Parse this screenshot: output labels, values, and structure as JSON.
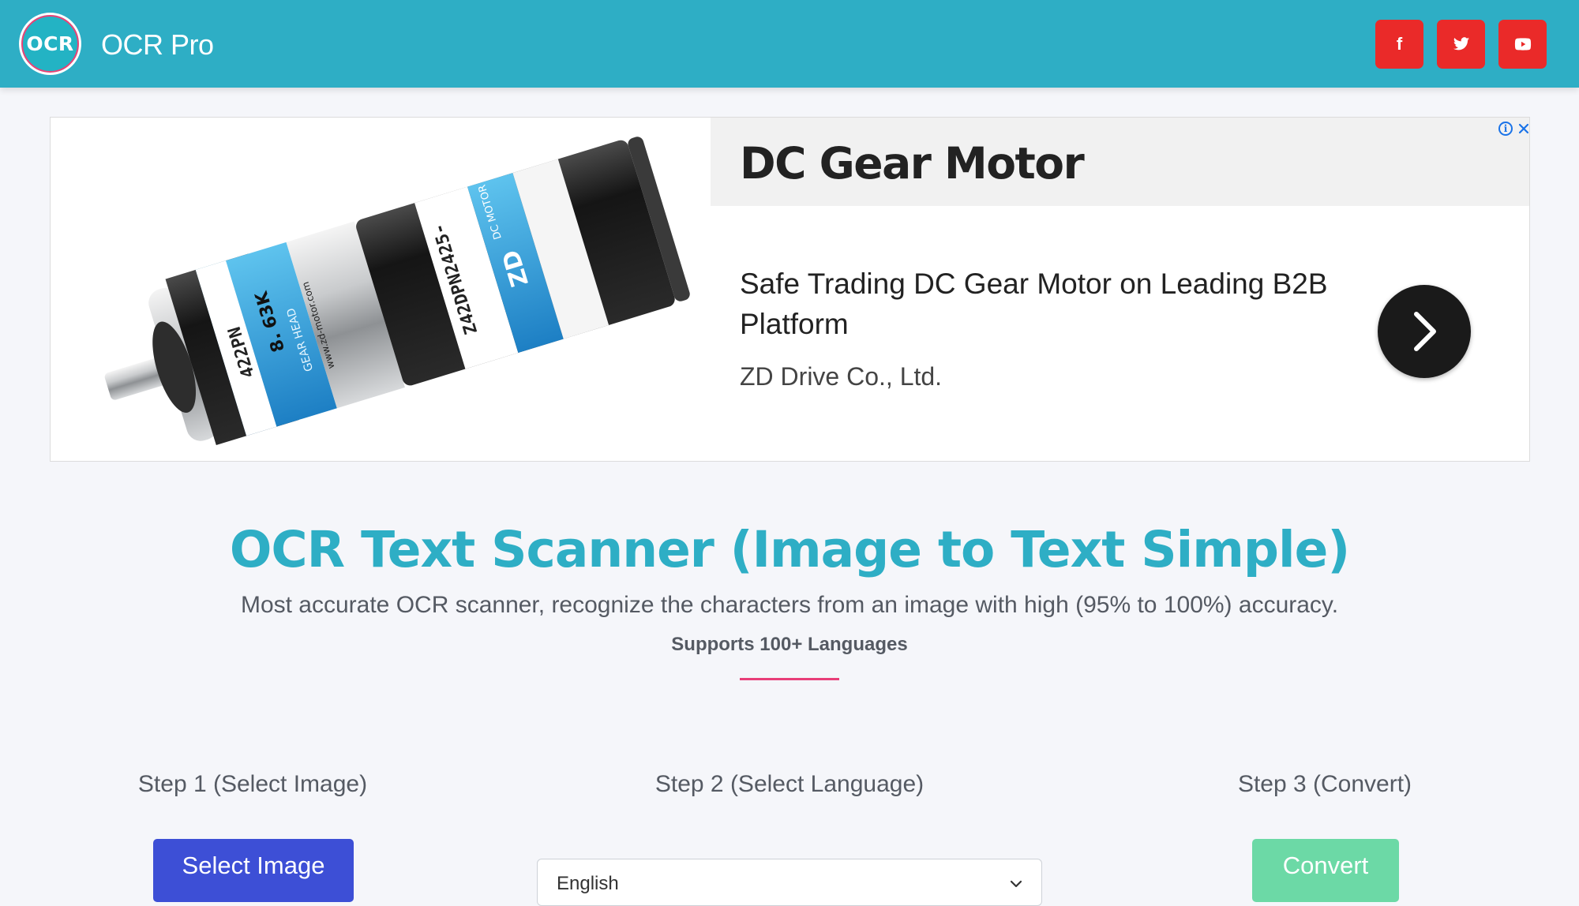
{
  "header": {
    "logo_text": "OCR",
    "brand": "OCR Pro",
    "social": [
      {
        "name": "facebook",
        "glyph": "f"
      },
      {
        "name": "twitter"
      },
      {
        "name": "youtube"
      }
    ],
    "social_color": "#ea2a29",
    "background": "#2eaec5"
  },
  "ad": {
    "headline": "DC Gear Motor",
    "description": "Safe Trading DC Gear Motor on Leading B2B Platform",
    "advertiser": "ZD Drive Co., Ltd.",
    "image_labels": {
      "label_a": "422PN",
      "label_b": "8. 63K",
      "label_c": "GEAR HEAD",
      "label_d": "www.zd-motor.com",
      "label_e": "Z42DPN2425-",
      "label_f": "DC MOTOR",
      "brand_mark": "ZD"
    }
  },
  "hero": {
    "title": "OCR Text Scanner (Image to Text Simple)",
    "subtitle": "Most accurate OCR scanner, recognize the characters from an image with high (95% to 100%) accuracy.",
    "supports": "Supports 100+ Languages"
  },
  "steps": {
    "step1_label": "Step 1 (Select Image)",
    "step2_label": "Step 2 (Select Language)",
    "step3_label": "Step 3 (Convert)",
    "select_button": "Select Image",
    "language_selected": "English",
    "convert_button": "Convert"
  },
  "colors": {
    "accent": "#2eaec5",
    "divider": "#e83e78",
    "select_button": "#3d4fd6",
    "convert_button": "#6cd9a6"
  }
}
